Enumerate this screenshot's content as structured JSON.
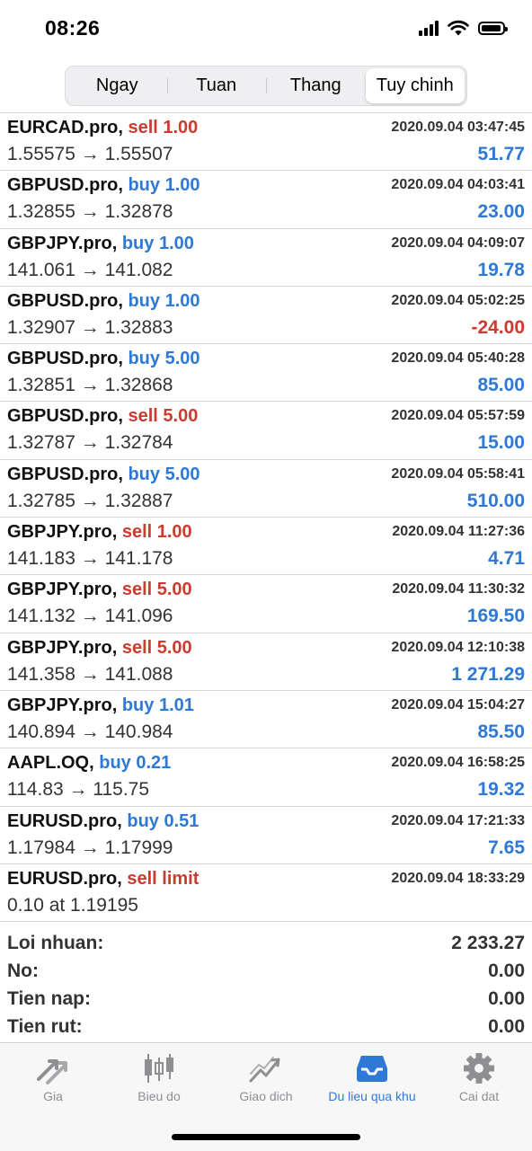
{
  "status_bar": {
    "time": "08:26"
  },
  "tabs": {
    "items": [
      {
        "label": "Ngay"
      },
      {
        "label": "Tuan"
      },
      {
        "label": "Thang"
      },
      {
        "label": "Tuy chinh"
      }
    ],
    "selected": "Tuy chinh"
  },
  "trades": [
    {
      "symbol": "EURCAD.pro,",
      "side": "sell",
      "action": "sell 1.00",
      "datetime": "2020.09.04 03:47:45",
      "prices": "1.55575 → 1.55507",
      "profit": "51.77",
      "profit_sign": "pos"
    },
    {
      "symbol": "GBPUSD.pro,",
      "side": "buy",
      "action": "buy 1.00",
      "datetime": "2020.09.04 04:03:41",
      "prices": "1.32855 → 1.32878",
      "profit": "23.00",
      "profit_sign": "pos"
    },
    {
      "symbol": "GBPJPY.pro,",
      "side": "buy",
      "action": "buy 1.00",
      "datetime": "2020.09.04 04:09:07",
      "prices": "141.061 → 141.082",
      "profit": "19.78",
      "profit_sign": "pos"
    },
    {
      "symbol": "GBPUSD.pro,",
      "side": "buy",
      "action": "buy 1.00",
      "datetime": "2020.09.04 05:02:25",
      "prices": "1.32907 → 1.32883",
      "profit": "-24.00",
      "profit_sign": "neg"
    },
    {
      "symbol": "GBPUSD.pro,",
      "side": "buy",
      "action": "buy 5.00",
      "datetime": "2020.09.04 05:40:28",
      "prices": "1.32851 → 1.32868",
      "profit": "85.00",
      "profit_sign": "pos"
    },
    {
      "symbol": "GBPUSD.pro,",
      "side": "sell",
      "action": "sell 5.00",
      "datetime": "2020.09.04 05:57:59",
      "prices": "1.32787 → 1.32784",
      "profit": "15.00",
      "profit_sign": "pos"
    },
    {
      "symbol": "GBPUSD.pro,",
      "side": "buy",
      "action": "buy 5.00",
      "datetime": "2020.09.04 05:58:41",
      "prices": "1.32785 → 1.32887",
      "profit": "510.00",
      "profit_sign": "pos"
    },
    {
      "symbol": "GBPJPY.pro,",
      "side": "sell",
      "action": "sell 1.00",
      "datetime": "2020.09.04 11:27:36",
      "prices": "141.183 → 141.178",
      "profit": "4.71",
      "profit_sign": "pos"
    },
    {
      "symbol": "GBPJPY.pro,",
      "side": "sell",
      "action": "sell 5.00",
      "datetime": "2020.09.04 11:30:32",
      "prices": "141.132 → 141.096",
      "profit": "169.50",
      "profit_sign": "pos"
    },
    {
      "symbol": "GBPJPY.pro,",
      "side": "sell",
      "action": "sell 5.00",
      "datetime": "2020.09.04 12:10:38",
      "prices": "141.358 → 141.088",
      "profit": "1 271.29",
      "profit_sign": "pos"
    },
    {
      "symbol": "GBPJPY.pro,",
      "side": "buy",
      "action": "buy 1.01",
      "datetime": "2020.09.04 15:04:27",
      "prices": "140.894 → 140.984",
      "profit": "85.50",
      "profit_sign": "pos"
    },
    {
      "symbol": "AAPL.OQ,",
      "side": "buy",
      "action": "buy 0.21",
      "datetime": "2020.09.04 16:58:25",
      "prices": "114.83 → 115.75",
      "profit": "19.32",
      "profit_sign": "pos"
    },
    {
      "symbol": "EURUSD.pro,",
      "side": "buy",
      "action": "buy 0.51",
      "datetime": "2020.09.04 17:21:33",
      "prices": "1.17984 → 1.17999",
      "profit": "7.65",
      "profit_sign": "pos"
    },
    {
      "symbol": "EURUSD.pro,",
      "side": "sell",
      "action": "sell limit",
      "datetime": "2020.09.04 18:33:29",
      "prices": "0.10 at 1.19195",
      "profit": "",
      "profit_sign": "pos"
    }
  ],
  "summary": [
    {
      "label": "Loi nhuan:",
      "value": "2 233.27"
    },
    {
      "label": "No:",
      "value": "0.00"
    },
    {
      "label": "Tien nap:",
      "value": "0.00"
    },
    {
      "label": "Tien rut:",
      "value": "0.00"
    }
  ],
  "bottom_nav": [
    {
      "label": "Gia",
      "icon": "quotes-arrows-icon"
    },
    {
      "label": "Bieu do",
      "icon": "candlestick-chart-icon"
    },
    {
      "label": "Giao dich",
      "icon": "trade-chart-icon"
    },
    {
      "label": "Du lieu qua khu",
      "icon": "history-inbox-icon"
    },
    {
      "label": "Cai dat",
      "icon": "gear-icon"
    }
  ],
  "active_nav": "Du lieu qua khu",
  "colors": {
    "buy": "#2f79d6",
    "sell": "#cc3b2e",
    "accent": "#2f79d6",
    "inactive": "#8e8e93"
  }
}
